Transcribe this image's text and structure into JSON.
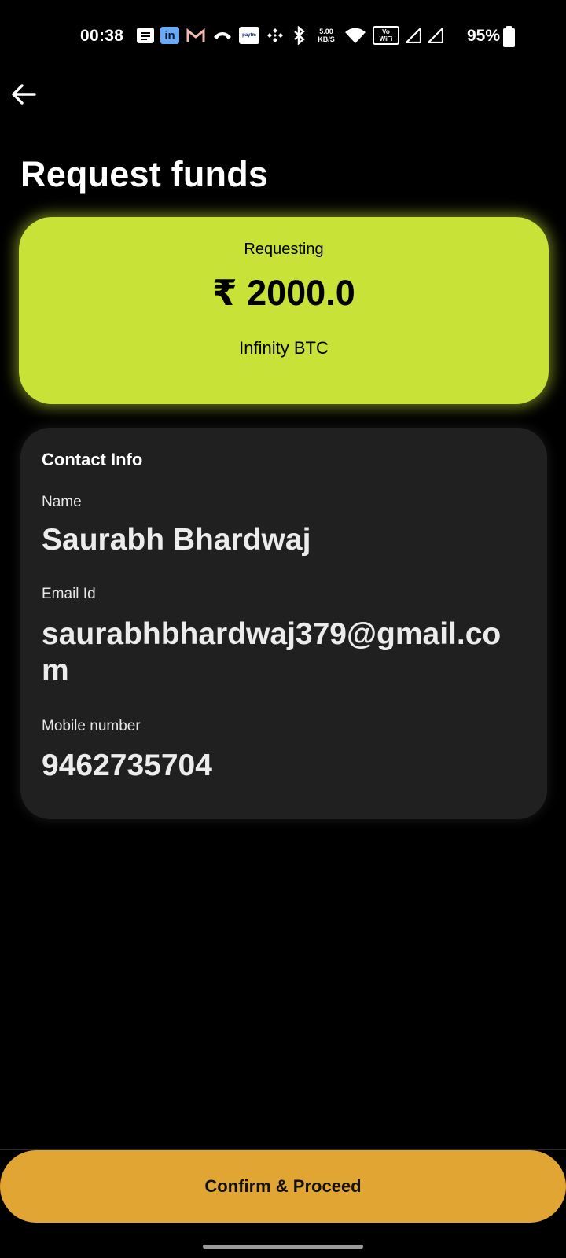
{
  "status_bar": {
    "time": "00:38",
    "net_speed_value": "5.00",
    "net_speed_unit": "KB/S",
    "vowifi_top": "Vo",
    "vowifi_bottom": "WiFi",
    "battery_percent": "95%",
    "icons": [
      "notes-icon",
      "linkedin-icon",
      "gmail-icon",
      "call-icon",
      "paytm-icon",
      "binance-icon",
      "bluetooth-icon",
      "network-speed-icon",
      "wifi-icon",
      "vowifi-icon",
      "signal-icon",
      "signal-icon",
      "battery-icon"
    ]
  },
  "header": {
    "title": "Request funds"
  },
  "request_card": {
    "label": "Requesting",
    "amount": "₹ 2000.0",
    "wallet": "Infinity BTC",
    "color": "#c9e238"
  },
  "contact": {
    "heading": "Contact Info",
    "name_label": "Name",
    "name_value": "Saurabh Bhardwaj",
    "email_label": "Email Id",
    "email_value": "saurabhbhardwaj379@gmail.com",
    "mobile_label": "Mobile number",
    "mobile_value": "9462735704"
  },
  "actions": {
    "confirm_label": "Confirm & Proceed",
    "confirm_color": "#e1a533"
  }
}
